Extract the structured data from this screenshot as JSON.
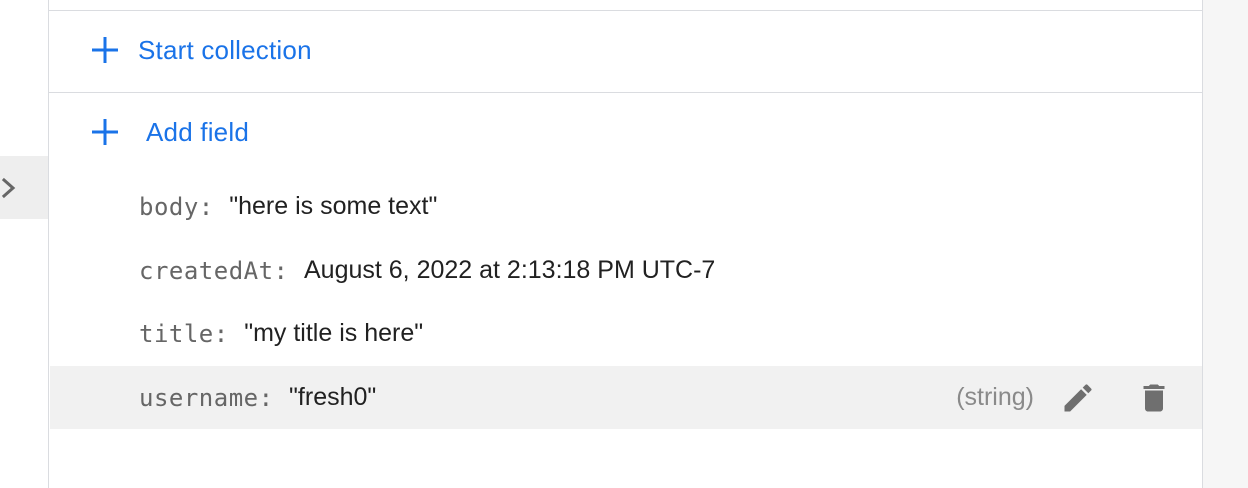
{
  "panel": {
    "start_collection_label": "Start collection",
    "add_field_label": "Add field"
  },
  "fields": [
    {
      "key": "body",
      "colon": ":",
      "value": "\"here is some text\""
    },
    {
      "key": "createdAt",
      "colon": ":",
      "value": "August 6, 2022 at 2:13:18 PM UTC-7"
    },
    {
      "key": "title",
      "colon": ":",
      "value": "\"my title is here\""
    },
    {
      "key": "username",
      "colon": ":",
      "value": "\"fresh0\"",
      "type": "(string)"
    }
  ],
  "icons": {
    "expand": "chevron-right-icon",
    "add": "plus-icon",
    "edit": "pencil-icon",
    "delete": "trash-icon"
  },
  "colors": {
    "accent": "#1a73e8",
    "key_text": "#666666",
    "value_text": "#212121",
    "type_text": "#8a8a8a",
    "icon_gray": "#6f6f6f",
    "hover_row": "#f1f1f1",
    "divider": "#dadce0"
  }
}
